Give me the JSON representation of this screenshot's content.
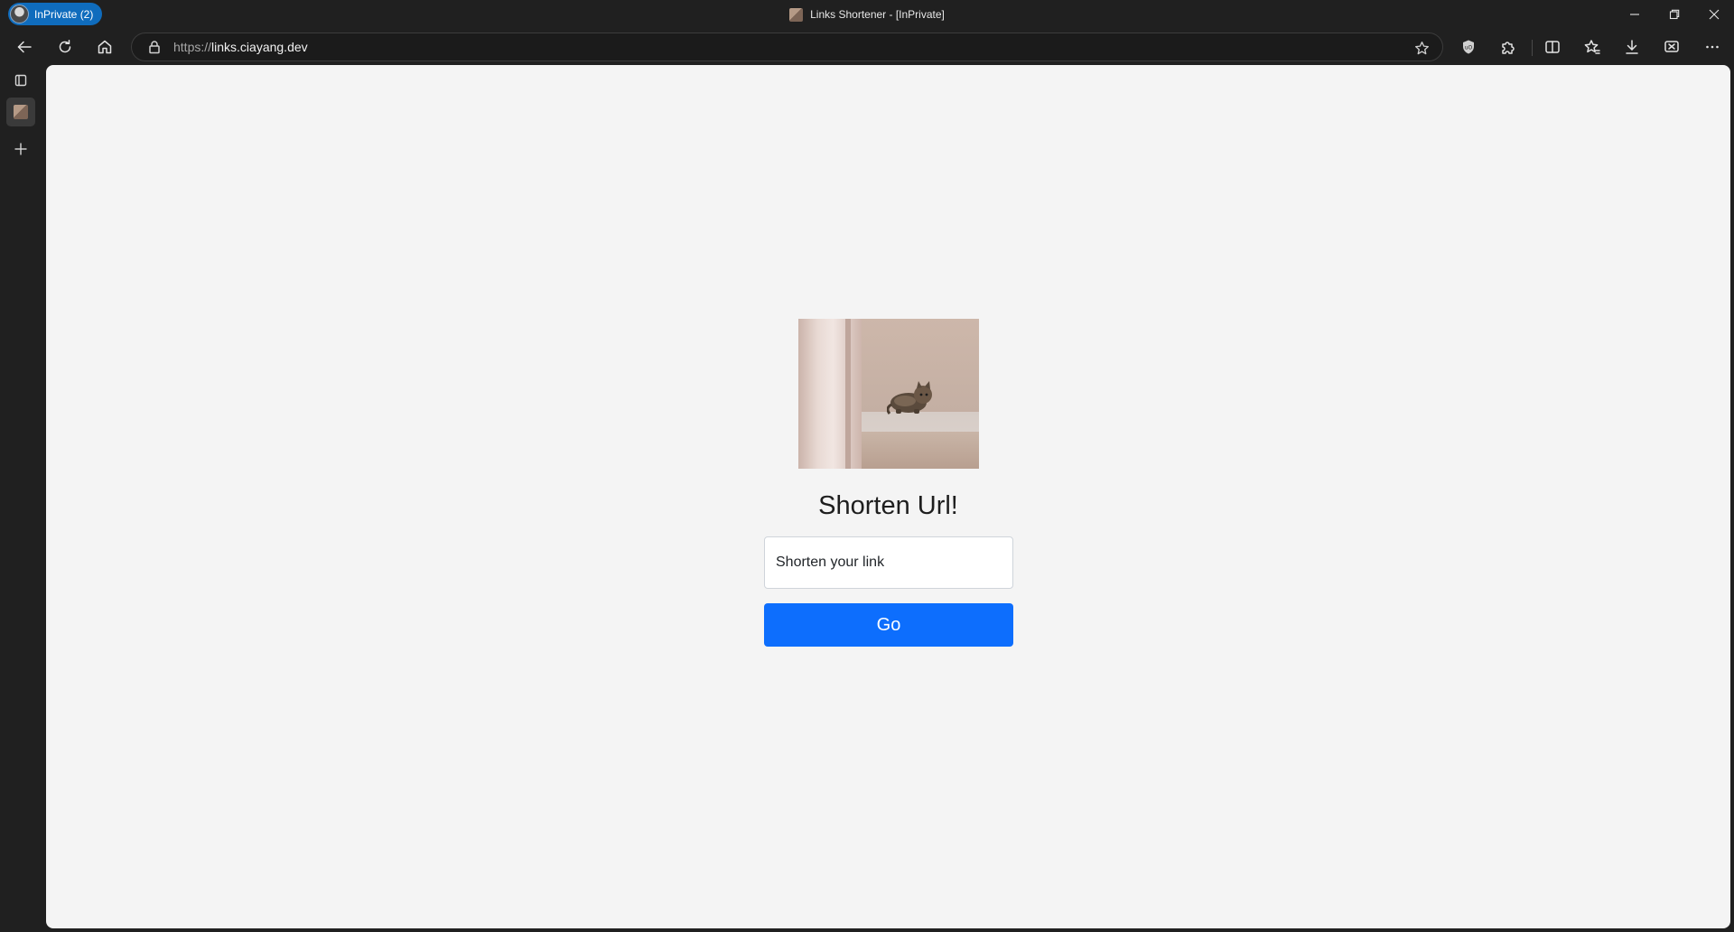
{
  "window": {
    "title": "Links Shortener - [InPrivate]",
    "profile_label": "InPrivate (2)"
  },
  "toolbar": {
    "url_scheme": "https://",
    "url_host": "links.ciayang.dev"
  },
  "page": {
    "heading": "Shorten Url!",
    "input_value": "Shorten your link",
    "go_label": "Go",
    "accent_color": "#0d6efd",
    "image_subject": "cat"
  },
  "icons": {
    "back": "back-arrow-icon",
    "refresh": "refresh-icon",
    "home": "home-icon",
    "lock": "lock-icon",
    "favorite": "star-icon",
    "shield": "shield-extension-icon",
    "extensions": "puzzle-icon",
    "split": "split-screen-icon",
    "favorites": "favorites-icon",
    "downloads": "download-icon",
    "screenshot": "screenshot-icon",
    "more": "more-icon"
  }
}
